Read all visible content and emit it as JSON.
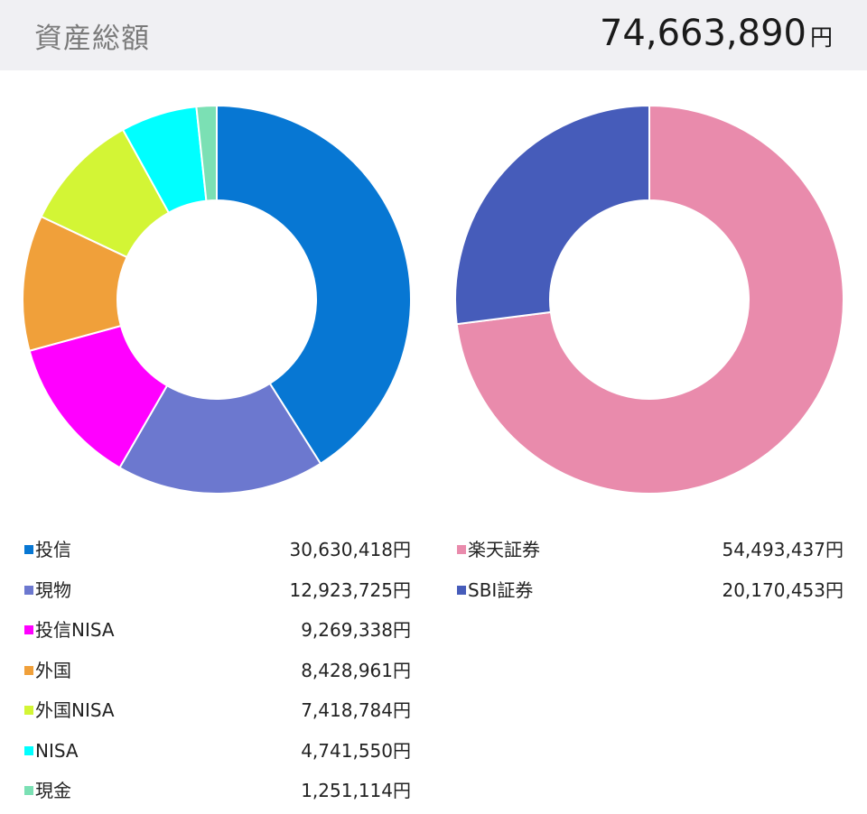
{
  "header": {
    "title": "資産総額",
    "total_value": "74,663,890",
    "total_unit": "円"
  },
  "chart_data": [
    {
      "type": "pie",
      "variant": "donut",
      "categories": [
        "投信",
        "現物",
        "投信NISA",
        "外国",
        "外国NISA",
        "NISA",
        "現金"
      ],
      "values": [
        30630418,
        12923725,
        9269338,
        8428961,
        7418784,
        4741550,
        1251114
      ],
      "labels": [
        "30,630,418円",
        "12,923,725円",
        "9,269,338円",
        "8,428,961円",
        "7,418,784円",
        "4,741,550円",
        "1,251,114円"
      ],
      "colors": [
        "#0777d3",
        "#6c78cf",
        "#ff00ff",
        "#f0a03a",
        "#d3f535",
        "#00ffff",
        "#7be0b4"
      ],
      "legend": "bottom"
    },
    {
      "type": "pie",
      "variant": "donut",
      "categories": [
        "楽天証券",
        "SBI証券"
      ],
      "values": [
        54493437,
        20170453
      ],
      "labels": [
        "54,493,437円",
        "20,170,453円"
      ],
      "colors": [
        "#e98bac",
        "#465cba"
      ],
      "legend": "bottom"
    }
  ]
}
